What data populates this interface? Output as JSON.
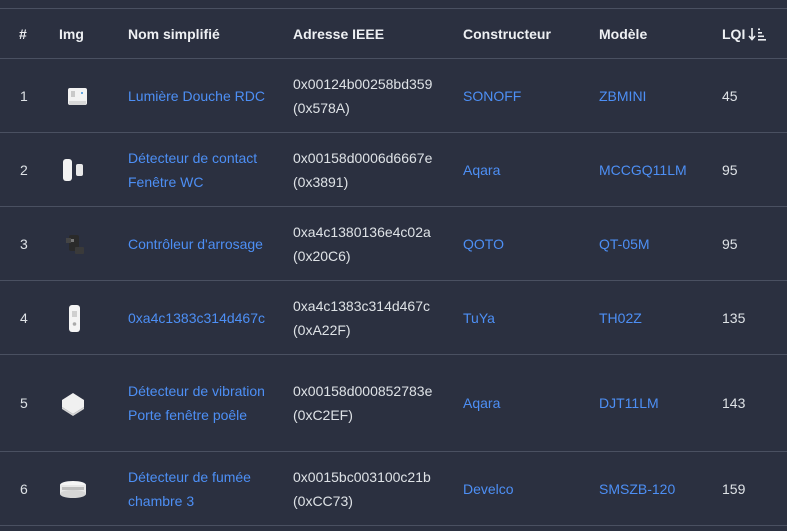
{
  "header": {
    "num": "#",
    "img": "Img",
    "name": "Nom simplifié",
    "ieee": "Adresse IEEE",
    "manufacturer": "Constructeur",
    "model": "Modèle",
    "lqi": "LQI",
    "lqi_sort_icon": "sort-descending-icon"
  },
  "rows": [
    {
      "num": "1",
      "img_icon": "sonoff-switch-icon",
      "name": "Lumière Douche RDC",
      "ieee": "0x00124b00258bd359",
      "nwk": "(0x578A)",
      "manufacturer": "SONOFF",
      "model": "ZBMINI",
      "lqi": "45"
    },
    {
      "num": "2",
      "img_icon": "contact-sensor-icon",
      "name": "Détecteur de contact Fenêtre WC",
      "ieee": "0x00158d0006d6667e",
      "nwk": "(0x3891)",
      "manufacturer": "Aqara",
      "model": "MCCGQ11LM",
      "lqi": "95"
    },
    {
      "num": "3",
      "img_icon": "water-valve-icon",
      "name": "Contrôleur d'arrosage",
      "ieee": "0xa4c1380136e4c02a",
      "nwk": "(0x20C6)",
      "manufacturer": "QOTO",
      "model": "QT-05M",
      "lqi": "95"
    },
    {
      "num": "4",
      "img_icon": "temperature-sensor-icon",
      "name": "0xa4c1383c314d467c",
      "ieee": "0xa4c1383c314d467c",
      "nwk": "(0xA22F)",
      "manufacturer": "TuYa",
      "model": "TH02Z",
      "lqi": "135"
    },
    {
      "num": "5",
      "img_icon": "vibration-sensor-icon",
      "name": "Détecteur de vibration Porte fenêtre poêle",
      "ieee": "0x00158d000852783e",
      "nwk": "(0xC2EF)",
      "manufacturer": "Aqara",
      "model": "DJT11LM",
      "lqi": "143"
    },
    {
      "num": "6",
      "img_icon": "smoke-detector-icon",
      "name": "Détecteur de fumée chambre 3",
      "ieee": "0x0015bc003100c21b",
      "nwk": "(0xCC73)",
      "manufacturer": "Develco",
      "model": "SMSZB-120",
      "lqi": "159"
    }
  ]
}
